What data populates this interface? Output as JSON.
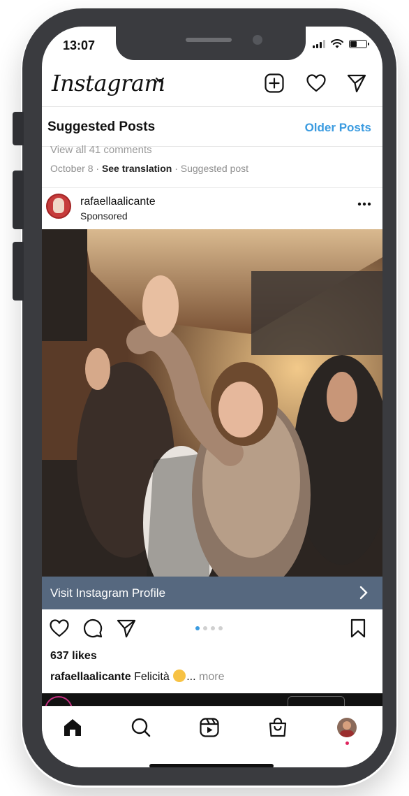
{
  "status_bar": {
    "time": "13:07"
  },
  "header": {
    "logo": "Instagram",
    "new_post_icon": "plus-square-icon",
    "activity_icon": "heart-icon",
    "direct_icon": "paper-plane-icon"
  },
  "suggested": {
    "title": "Suggested Posts",
    "older_label": "Older Posts"
  },
  "prev_post": {
    "view_comments": "View all 41 comments",
    "date": "October 8",
    "see_translation": "See translation",
    "suggested_label": "Suggested post"
  },
  "post": {
    "username": "rafaellaalicante",
    "sponsored_label": "Sponsored",
    "cta_label": "Visit Instagram Profile",
    "likes": "637 likes",
    "caption_user": "rafaellaalicante",
    "caption_text": "Felicità",
    "caption_more": "more",
    "carousel_total": 4,
    "carousel_active": 1
  },
  "bottom_nav": {
    "items": [
      "home-icon",
      "search-icon",
      "reels-icon",
      "shop-icon",
      "profile-avatar"
    ]
  },
  "colors": {
    "accent_blue": "#3a9be0",
    "cta_bar": "#56687f",
    "phone_frame": "#3a3b3f",
    "notification_dot": "#e0245e"
  }
}
